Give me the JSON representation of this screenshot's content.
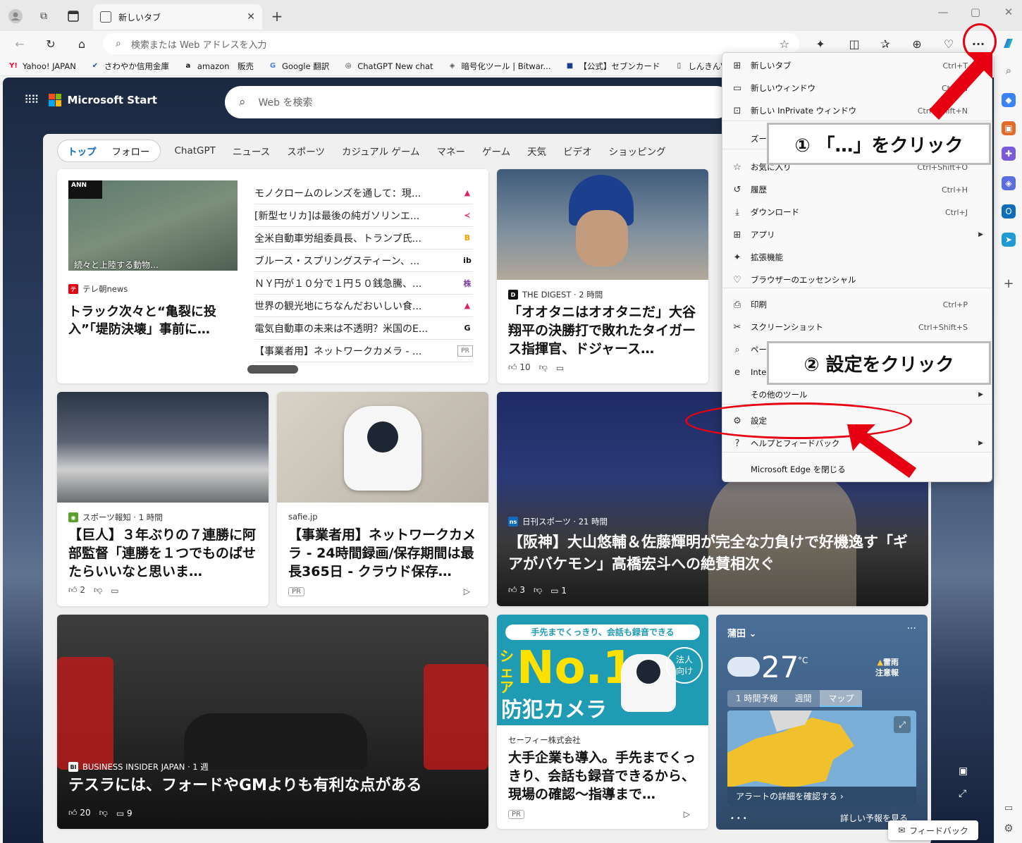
{
  "browser": {
    "tab_title": "新しいタブ",
    "tab_close": "✕",
    "new_tab": "+",
    "address_placeholder": "検索または Web アドレスを入力"
  },
  "favorites": [
    {
      "icon_text": "Y!",
      "icon_color": "#ff0033",
      "label": "Yahoo! JAPAN"
    },
    {
      "icon_text": "✔",
      "icon_color": "#1a4ea8",
      "label": "さわやか信用金庫"
    },
    {
      "icon_text": "a",
      "icon_color": "#111111",
      "label": "amazon　販売"
    },
    {
      "icon_text": "G",
      "icon_color": "#4285f4",
      "label": "Google 翻訳"
    },
    {
      "icon_text": "◎",
      "icon_color": "#333333",
      "label": "ChatGPT New chat"
    },
    {
      "icon_text": "◈",
      "icon_color": "#555555",
      "label": "暗号化ツール | Bitwar..."
    },
    {
      "icon_text": "■",
      "icon_color": "#1a3e8c",
      "label": "【公式】セブンカード"
    },
    {
      "icon_text": "▯",
      "icon_color": "#333333",
      "label": "しんきんVISAカード"
    }
  ],
  "msn": {
    "brand": "Microsoft Start",
    "search_placeholder": "Web を検索",
    "pill_tabs": [
      "トップ",
      "フォロー"
    ],
    "tabs": [
      "ChatGPT",
      "ニュース",
      "スポーツ",
      "カジュアル ゲーム",
      "マネー",
      "ゲーム",
      "天気",
      "ビデオ",
      "ショッピング"
    ]
  },
  "cards": {
    "c1": {
      "source": "テレ朝news",
      "headline": "トラック次々と“亀裂に投入”「堤防決壊」事前に…",
      "caption": "続々と上陸する動物…"
    },
    "list": [
      {
        "text": "モノクロームのレンズを通して：現...",
        "icon": "▲",
        "color": "#e0245e"
      },
      {
        "text": "[新型セリカ]は最後の純ガソリンエ...",
        "icon": "≺",
        "color": "#e0245e"
      },
      {
        "text": "全米自動車労組委員長、トランプ氏...",
        "icon": "B",
        "color": "#f29c00"
      },
      {
        "text": "ブルース・スプリングスティーン、...",
        "icon": "ib",
        "color": "#111111"
      },
      {
        "text": "ＮＹ円が１０分で１円５０銭急騰、...",
        "icon": "株",
        "color": "#7b3fa0"
      },
      {
        "text": "世界の観光地にちなんだおいしい食...",
        "icon": "▲",
        "color": "#e0245e"
      },
      {
        "text": "電気自動車の未来は不透明？米国のE...",
        "icon": "G",
        "color": "#111111"
      },
      {
        "text": "【事業者用】ネットワークカメラ - ...",
        "icon": "PR",
        "color": "#666666"
      }
    ],
    "c2": {
      "source": "THE DIGEST · 2 時間",
      "headline": "「オオタニはオオタニだ」大谷翔平の決勝打で敗れたタイガース指揮官、ドジャース…",
      "likes": "10"
    },
    "c3": {
      "source": "スポーツ報知 · 1 時間",
      "headline": "【巨人】３年ぶりの７連勝に阿部監督「連勝を１つでものばせたらいいなと思いま…",
      "likes": "2"
    },
    "c4": {
      "source": "safie.jp",
      "headline": "【事業者用】ネットワークカメラ - 24時間録画/保存期間は最長365日 - クラウド保存…",
      "pr": "PR"
    },
    "c5": {
      "source": "日刊スポーツ · 21 時間",
      "headline": "【阪神】大山悠輔＆佐藤輝明が完全な力負けで好機逸す「ギアがバケモン」高橋宏斗への絶賛相次ぐ",
      "likes": "3",
      "comments": "1"
    },
    "c6": {
      "source": "BUSINESS INSIDER JAPAN · 1 週",
      "headline": "テスラには、フォードやGMよりも有利な点がある",
      "likes": "20",
      "comments": "9"
    },
    "c7": {
      "banner": "手先までくっきり、会話も録音できる",
      "big": "No.1",
      "side": "シェア",
      "sub": "防犯カメラ",
      "badge": "法人向け",
      "source": "セーフィー株式会社",
      "headline": "大手企業も導入。手先までくっきり、会話も録音できるから、現場の確認〜指導まで…",
      "pr": "PR"
    }
  },
  "weather": {
    "location": "蒲田",
    "temp": "27",
    "unit": "°C",
    "alert": "雷雨\n注意報",
    "alert_line1": "雷雨",
    "alert_line2": "注意報",
    "tabs": [
      "1 時間予報",
      "週間",
      "マップ"
    ],
    "alert_link": "アラートの詳細を確認する ›",
    "more": "詳しい予報を見る"
  },
  "feedback": "フィードバック",
  "menu": {
    "items": [
      {
        "icon": "⊞",
        "label": "新しいタブ",
        "shortcut": "Ctrl+T"
      },
      {
        "icon": "▭",
        "label": "新しいウィンドウ",
        "shortcut": "Ctrl+N"
      },
      {
        "icon": "⊡",
        "label": "新しい InPrivate ウィンドウ",
        "shortcut": "Ctrl+Shift+N"
      },
      {
        "icon": "",
        "label": "ズーム",
        "shortcut": ""
      },
      {
        "icon": "☆",
        "label": "お気に入り",
        "shortcut": "Ctrl+Shift+O"
      },
      {
        "icon": "↺",
        "label": "履歴",
        "shortcut": "Ctrl+H"
      },
      {
        "icon": "⤓",
        "label": "ダウンロード",
        "shortcut": "Ctrl+J"
      },
      {
        "icon": "⊞",
        "label": "アプリ",
        "shortcut": ""
      },
      {
        "icon": "✦",
        "label": "拡張機能",
        "shortcut": ""
      },
      {
        "icon": "♡",
        "label": "ブラウザーのエッセンシャル",
        "shortcut": ""
      },
      {
        "icon": "⎙",
        "label": "印刷",
        "shortcut": "Ctrl+P"
      },
      {
        "icon": "✂",
        "label": "スクリーンショット",
        "shortcut": "Ctrl+Shift+S"
      },
      {
        "icon": "⌕",
        "label": "ページ",
        "shortcut": ""
      },
      {
        "icon": "e",
        "label": "Inter",
        "shortcut": ""
      },
      {
        "icon": "",
        "label": "その他のツール",
        "shortcut": ""
      },
      {
        "icon": "⚙",
        "label": "設定",
        "shortcut": ""
      },
      {
        "icon": "?",
        "label": "ヘルプとフィードバック",
        "shortcut": ""
      },
      {
        "icon": "",
        "label": "Microsoft Edge を閉じる",
        "shortcut": ""
      }
    ]
  },
  "annotations": {
    "step1": "① 「…」をクリック",
    "step2": "② 設定をクリック"
  }
}
